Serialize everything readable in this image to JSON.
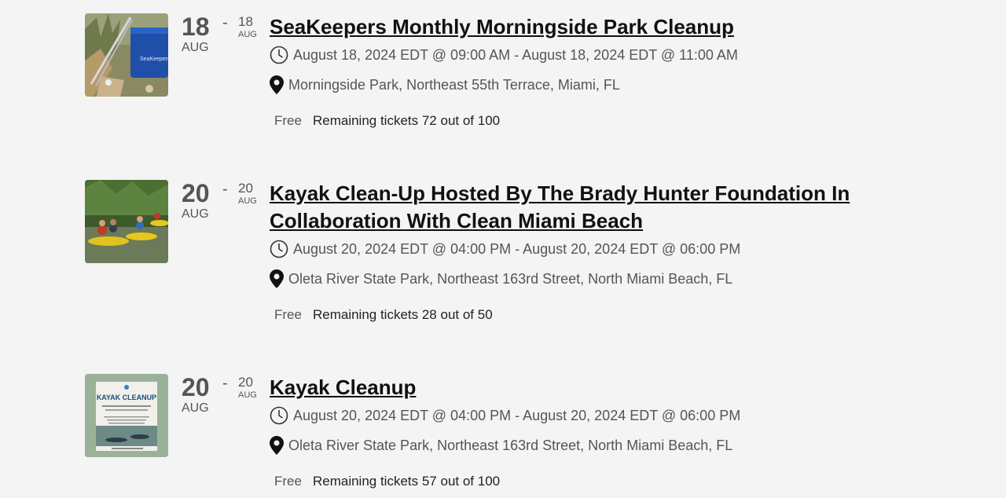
{
  "events": [
    {
      "start_day": "18",
      "start_month": "AUG",
      "separator": "-",
      "end_day": "18",
      "end_month": "AUG",
      "title": "SeaKeepers Monthly Morningside Park Cleanup",
      "datetime": "August 18, 2024 EDT @ 09:00 AM - August 18, 2024 EDT @ 11:00 AM",
      "location": "Morningside Park, Northeast 55th Terrace, Miami, FL",
      "price": "Free",
      "tickets": "Remaining tickets 72 out of 100"
    },
    {
      "start_day": "20",
      "start_month": "AUG",
      "separator": "-",
      "end_day": "20",
      "end_month": "AUG",
      "title": "Kayak Clean-Up Hosted By The Brady Hunter Foundation In Collaboration With Clean Miami Beach",
      "datetime": "August 20, 2024 EDT @ 04:00 PM - August 20, 2024 EDT @ 06:00 PM",
      "location": "Oleta River State Park, Northeast 163rd Street, North Miami Beach, FL",
      "price": "Free",
      "tickets": "Remaining tickets 28 out of 50"
    },
    {
      "start_day": "20",
      "start_month": "AUG",
      "separator": "-",
      "end_day": "20",
      "end_month": "AUG",
      "title": "Kayak Cleanup",
      "datetime": "August 20, 2024 EDT @ 04:00 PM - August 20, 2024 EDT @ 06:00 PM",
      "location": "Oleta River State Park, Northeast 163rd Street, North Miami Beach, FL",
      "price": "Free",
      "tickets": "Remaining tickets 57 out of 100",
      "poster_heading": "KAYAK CLEANUP"
    }
  ]
}
